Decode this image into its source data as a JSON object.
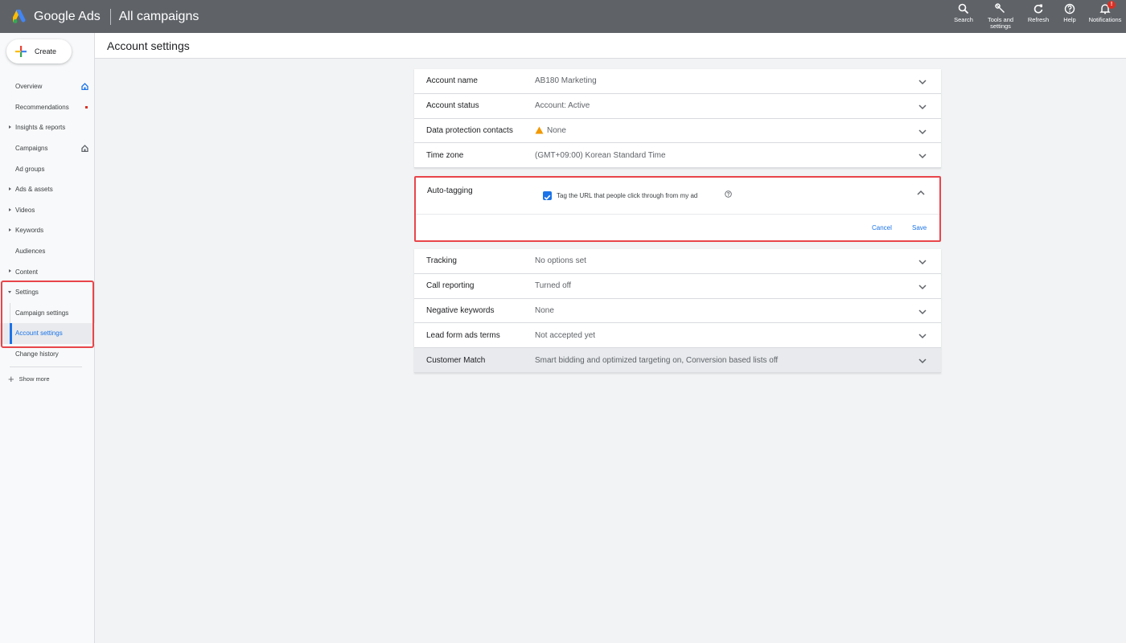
{
  "topbar": {
    "brand": "Google Ads",
    "campaign_title": "All campaigns",
    "actions": {
      "search": "Search",
      "tools_line1": "Tools and",
      "tools_line2": "settings",
      "refresh": "Refresh",
      "help": "Help",
      "notifications": "Notifications",
      "notification_badge": "!"
    }
  },
  "sidebar": {
    "create_label": "Create",
    "items": {
      "overview": "Overview",
      "recommendations": "Recommendations",
      "insights": "Insights & reports",
      "campaigns": "Campaigns",
      "ad_groups": "Ad groups",
      "ads_assets": "Ads & assets",
      "videos": "Videos",
      "keywords": "Keywords",
      "audiences": "Audiences",
      "content": "Content",
      "settings": "Settings",
      "campaign_settings": "Campaign settings",
      "account_settings": "Account settings",
      "change_history": "Change history"
    },
    "show_more": "Show more"
  },
  "page": {
    "title": "Account settings"
  },
  "settings": {
    "account_name": {
      "label": "Account name",
      "value": "AB180 Marketing"
    },
    "account_status": {
      "label": "Account status",
      "value": "Account: Active"
    },
    "data_protection": {
      "label": "Data protection contacts",
      "value": "None"
    },
    "time_zone": {
      "label": "Time zone",
      "value": "(GMT+09:00) Korean Standard Time"
    },
    "auto_tagging": {
      "label": "Auto-tagging",
      "checkbox_label": "Tag the URL that people click through from my ad",
      "checked": true,
      "cancel": "Cancel",
      "save": "Save"
    },
    "tracking": {
      "label": "Tracking",
      "value": "No options set"
    },
    "call_reporting": {
      "label": "Call reporting",
      "value": "Turned off"
    },
    "negative_keywords": {
      "label": "Negative keywords",
      "value": "None"
    },
    "lead_form": {
      "label": "Lead form ads terms",
      "value": "Not accepted yet"
    },
    "customer_match": {
      "label": "Customer Match",
      "value": "Smart bidding and optimized targeting on, Conversion based lists off"
    }
  },
  "colors": {
    "topbar": "#5f6368",
    "accent": "#1a73e8",
    "highlight": "#e8454a",
    "warning": "#f29900"
  }
}
